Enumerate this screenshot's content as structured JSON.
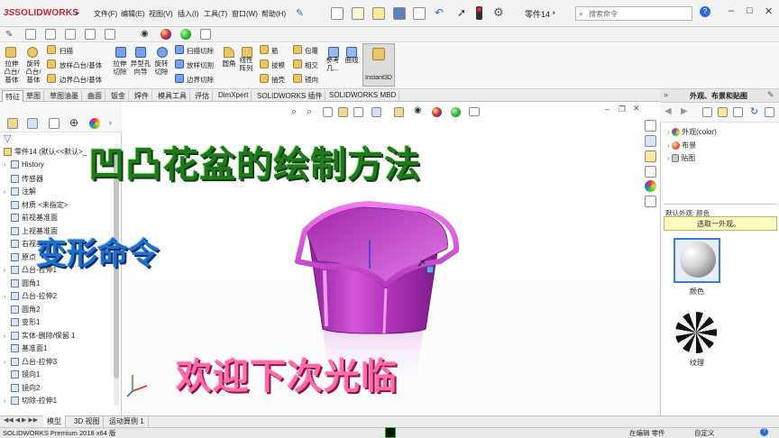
{
  "app": {
    "logo_prefix": "3S",
    "logo_text": "SOLIDWORKS",
    "document_title": "零件14 *",
    "search_placeholder": "搜索命令"
  },
  "menu": [
    "文件(F)",
    "编辑(E)",
    "视图(V)",
    "插入(I)",
    "工具(T)",
    "窗口(W)",
    "帮助(H)"
  ],
  "ribbon": {
    "extrude_boss": "拉伸\n凸台/\n基体",
    "revolve_boss": "旋转\n凸台/\n基体",
    "sweep": "扫描",
    "loft_boss": "放样凸台/基体",
    "boundary_boss": "边界凸台/基体",
    "extrude_cut": "拉伸\n切除",
    "hole_wizard": "异型孔\n向导",
    "revolve_cut": "旋转\n切除",
    "swept_cut": "扫描切除",
    "lofted_cut": "放样切割",
    "boundary_cut": "边界切除",
    "fillet": "圆角",
    "linear_pattern": "线性\n阵列",
    "rib": "筋",
    "draft": "拔模",
    "shell": "抽壳",
    "wrap": "包覆",
    "intersect": "相交",
    "mirror": "镜向",
    "reference_geometry": "参考\n几...",
    "curves": "曲线",
    "instant3d": "Instant3D"
  },
  "tabs": [
    "特征",
    "草图",
    "草图油墨",
    "曲面",
    "钣金",
    "焊件",
    "模具工具",
    "评估",
    "DimXpert",
    "SOLIDWORKS 插件",
    "SOLIDWORKS MBD"
  ],
  "tree": {
    "root": "零件14 (默认<<默认>_",
    "items": [
      {
        "label": "History",
        "expand": true
      },
      {
        "label": "传感器",
        "expand": false
      },
      {
        "label": "注解",
        "expand": true
      },
      {
        "label": "材质 <未指定>",
        "expand": false
      },
      {
        "label": "前视基准面",
        "expand": false
      },
      {
        "label": "上视基准面",
        "expand": false
      },
      {
        "label": "右视基准面",
        "expand": false
      },
      {
        "label": "原点",
        "expand": false
      },
      {
        "label": "凸台-拉伸1",
        "expand": true
      },
      {
        "label": "圆角1",
        "expand": false
      },
      {
        "label": "凸台-拉伸2",
        "expand": true
      },
      {
        "label": "圆角2",
        "expand": false
      },
      {
        "label": "变形1",
        "expand": false
      },
      {
        "label": "实体-删除/保留 1",
        "expand": true
      },
      {
        "label": "基准面1",
        "expand": false
      },
      {
        "label": "凸台-拉伸3",
        "expand": true
      },
      {
        "label": "镜向1",
        "expand": false
      },
      {
        "label": "镜向2",
        "expand": false
      },
      {
        "label": "切除-拉伸1",
        "expand": true
      }
    ]
  },
  "overlay": {
    "title": "凹凸花盆的绘制方法",
    "subtitle": "变形命令",
    "closing": "欢迎下次光临"
  },
  "right_panel": {
    "title": "外观、布景和贴图",
    "items": [
      "外观(color)",
      "布景",
      "贴图"
    ],
    "default_label": "默认外观: 颜色",
    "select_hint": "选取一外观。",
    "thumb1": "颜色",
    "thumb2": "纹理"
  },
  "bottom_tabs": [
    "模型",
    "3D 视图",
    "运动算例 1"
  ],
  "status": {
    "version": "SOLIDWORKS Premium 2018 x64 版",
    "editing": "在编辑 零件",
    "custom": "自定义"
  },
  "colors": {
    "pot": "#c33bc9",
    "title_green": "#1f7a1b",
    "subtitle_blue": "#1f6fcc",
    "closing_pink": "#ff6aa8",
    "brand_red": "#d2202f"
  }
}
